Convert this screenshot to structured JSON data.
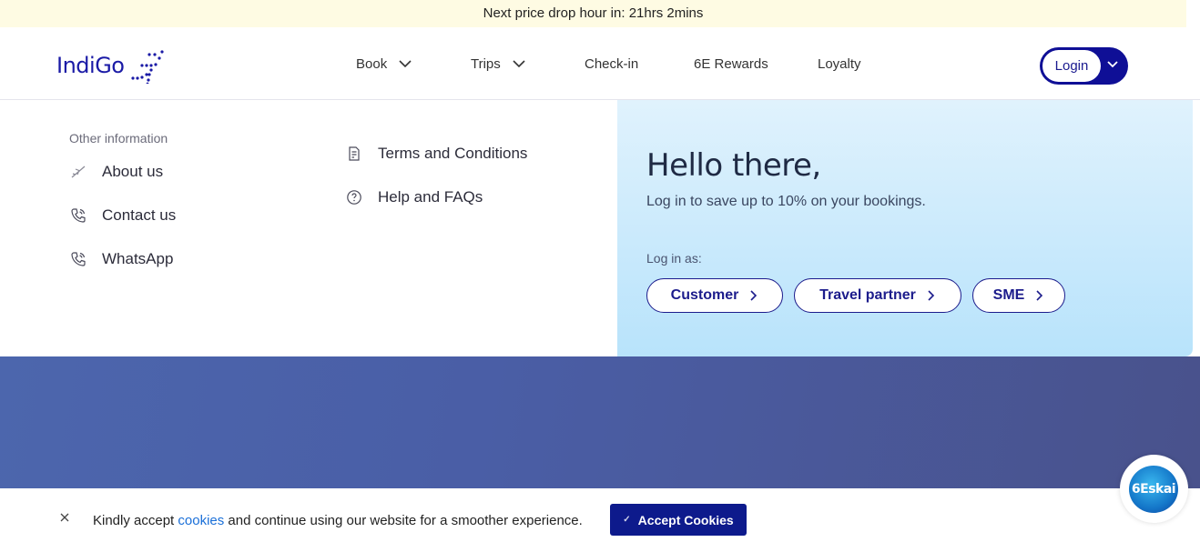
{
  "promo": {
    "text": "Next price drop hour in: 21hrs 2mins"
  },
  "header": {
    "logo_text": "IndiGo",
    "nav": [
      {
        "label": "Book",
        "has_dropdown": true
      },
      {
        "label": "Trips",
        "has_dropdown": true
      },
      {
        "label": "Check-in",
        "has_dropdown": false
      },
      {
        "label": "6E Rewards",
        "has_dropdown": false
      },
      {
        "label": "Loyalty",
        "has_dropdown": false
      }
    ],
    "login_label": "Login"
  },
  "dropdown": {
    "section_label": "Other information",
    "left_links": [
      {
        "label": "About us",
        "icon": "plane-icon"
      },
      {
        "label": "Contact us",
        "icon": "phone-icon"
      },
      {
        "label": "WhatsApp",
        "icon": "phone-icon"
      }
    ],
    "middle_links": [
      {
        "label": "Terms and Conditions",
        "icon": "document-icon"
      },
      {
        "label": "Help and FAQs",
        "icon": "help-icon"
      }
    ],
    "panel": {
      "title": "Hello there,",
      "subtitle": "Log in to save up to 10% on your bookings.",
      "login_as_label": "Log in as:",
      "roles": [
        "Customer",
        "Travel partner",
        "SME"
      ]
    }
  },
  "cookie_bar": {
    "text_before": "Kindly accept ",
    "link_text": "cookies",
    "text_after": " and continue using our website for a smoother experience.",
    "accept_label": "Accept Cookies"
  },
  "chat_widget": {
    "label": "6Eskai"
  },
  "colors": {
    "brand": "#1a1aa6",
    "login_bg": "#0f0f96",
    "promo_bg": "#fefbe3",
    "panel_bg": "#cbeafc",
    "hero_bg": "#4a5ea6",
    "accept_bg": "#0d1a8c",
    "link": "#1a6fd8"
  }
}
